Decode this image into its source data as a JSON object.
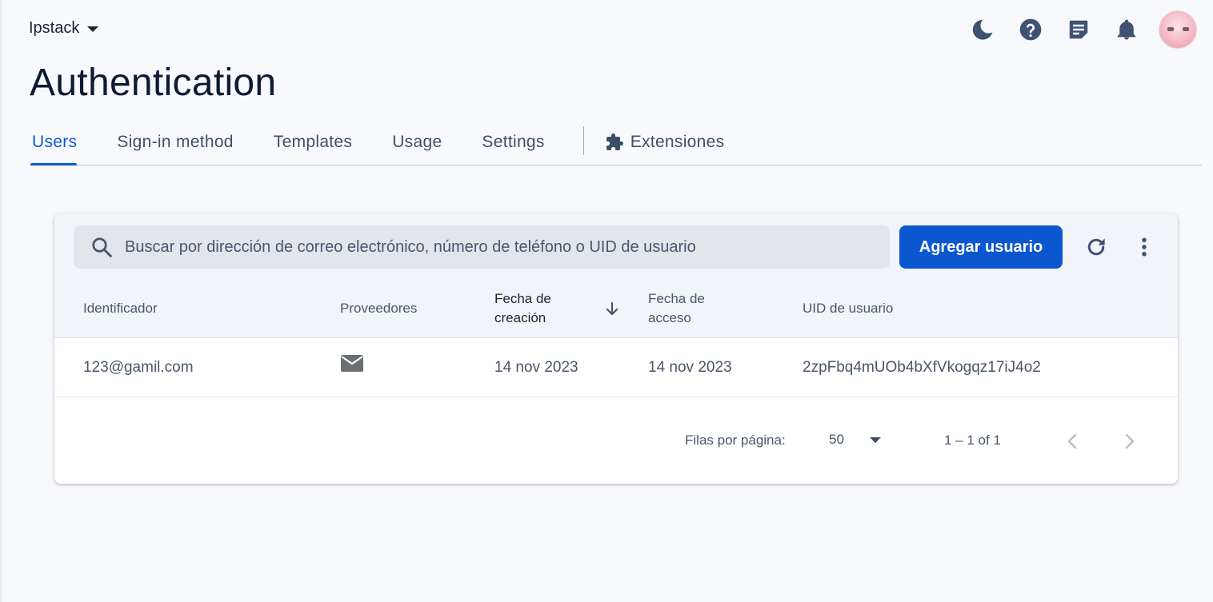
{
  "project": {
    "name": "Ipstack"
  },
  "header": {
    "title": "Authentication",
    "icons": [
      "moon-icon",
      "help-icon",
      "feedback-icon",
      "bell-icon",
      "avatar"
    ]
  },
  "tabs": [
    {
      "label": "Users",
      "active": true
    },
    {
      "label": "Sign-in method"
    },
    {
      "label": "Templates"
    },
    {
      "label": "Usage"
    },
    {
      "label": "Settings"
    },
    {
      "label": "Extensiones",
      "icon": "extension-icon"
    }
  ],
  "search": {
    "placeholder": "Buscar por dirección de correo electrónico, número de teléfono o UID de usuario",
    "value": ""
  },
  "toolbar": {
    "add_user_label": "Agregar usuario"
  },
  "table": {
    "columns": {
      "identifier": "Identificador",
      "providers": "Proveedores",
      "created_line1": "Fecha de",
      "created_line2": "creación",
      "signed_in_line1": "Fecha de",
      "signed_in_line2": "acceso",
      "uid": "UID de usuario"
    },
    "sort": {
      "column": "created",
      "direction": "descending"
    },
    "rows": [
      {
        "identifier": "123@gamil.com",
        "provider_icon": "email-icon",
        "created": "14 nov 2023",
        "signed_in": "14 nov 2023",
        "uid": "2zpFbq4mUOb4bXfVkogqz17iJ4o2"
      }
    ]
  },
  "pagination": {
    "rows_per_page_label": "Filas por página:",
    "rows_per_page": "50",
    "range": "1 – 1 of 1"
  },
  "colors": {
    "accent": "#0b57d0",
    "title": "#0c1a33",
    "icon": "#3f5272"
  }
}
